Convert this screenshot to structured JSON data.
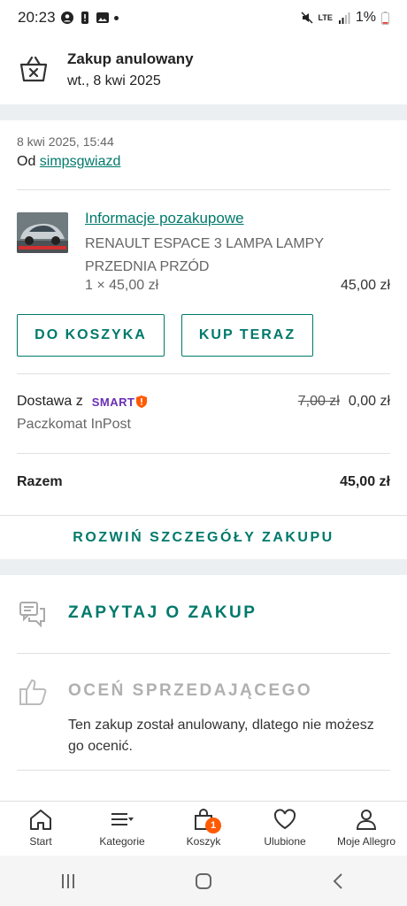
{
  "status_bar": {
    "time": "20:23",
    "battery": "1%",
    "network": "LTE"
  },
  "header": {
    "title": "Zakup anulowany",
    "date": "wt., 8 kwi 2025"
  },
  "purchase": {
    "datetime": "8 kwi 2025, 15:44",
    "from_label": "Od",
    "seller": "simpsgwiazd",
    "info_link": "Informacje pozakupowe",
    "item_title_line1": "RENAULT ESPACE 3 LAMPA LAMPY",
    "item_title_line2": "PRZEDNIA PRZÓD",
    "qty_price": "1 × 45,00 zł",
    "item_total": "45,00 zł",
    "btn_cart": "DO KOSZYKA",
    "btn_buy": "KUP TERAZ",
    "delivery_label": "Dostawa z",
    "smart_label": "SMART",
    "delivery_old_price": "7,00 zł",
    "delivery_price": "0,00 zł",
    "delivery_method": "Paczkomat InPost",
    "total_label": "Razem",
    "total_value": "45,00 zł",
    "expand_label": "ROZWIŃ SZCZEGÓŁY ZAKUPU"
  },
  "actions": {
    "ask_label": "ZAPYTAJ O ZAKUP",
    "rate_label": "OCEŃ SPRZEDAJĄCEGO",
    "rate_note_line1": "Ten zakup został anulowany, dlatego nie możesz",
    "rate_note_line2": "go ocenić."
  },
  "bottom_nav": [
    {
      "label": "Start",
      "icon": "home-icon"
    },
    {
      "label": "Kategorie",
      "icon": "menu-icon"
    },
    {
      "label": "Koszyk",
      "icon": "basket-icon",
      "badge": "1"
    },
    {
      "label": "Ulubione",
      "icon": "heart-icon"
    },
    {
      "label": "Moje Allegro",
      "icon": "person-icon"
    }
  ],
  "colors": {
    "accent": "#00796b",
    "badge": "#ff5a00",
    "smart": "#6a2fb3",
    "band": "#eceff1"
  }
}
